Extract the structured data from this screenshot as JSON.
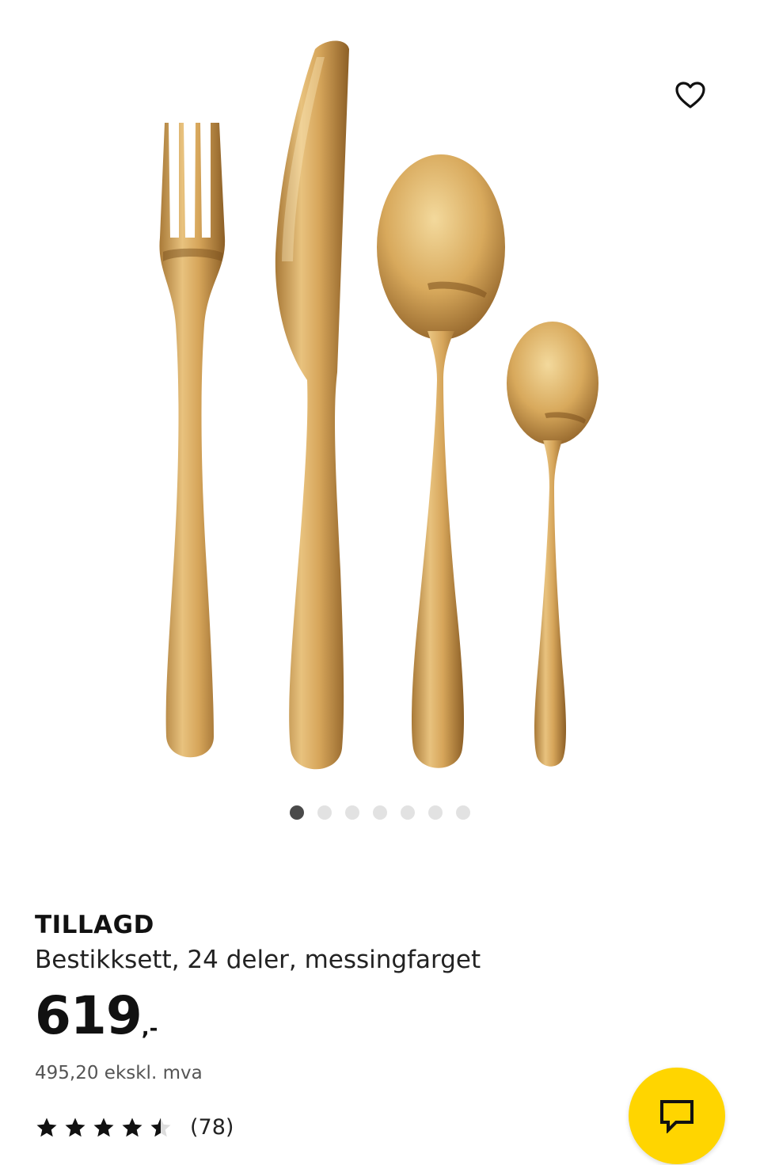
{
  "product": {
    "name": "TILLAGD",
    "description": "Bestikksett, 24 deler, messingfarget",
    "price_integer": "619",
    "price_suffix": ",-",
    "price_ex_vat": "495,20 ekskl. mva",
    "rating": 4.5,
    "rating_max": 5,
    "review_count": "(78)"
  },
  "gallery": {
    "image_count": 7,
    "active_index": 0,
    "accent_color": "#c9a45a",
    "favorite_icon": "heart-outline-icon"
  },
  "chat": {
    "icon": "chat-bubble-icon",
    "color": "#ffd500"
  }
}
